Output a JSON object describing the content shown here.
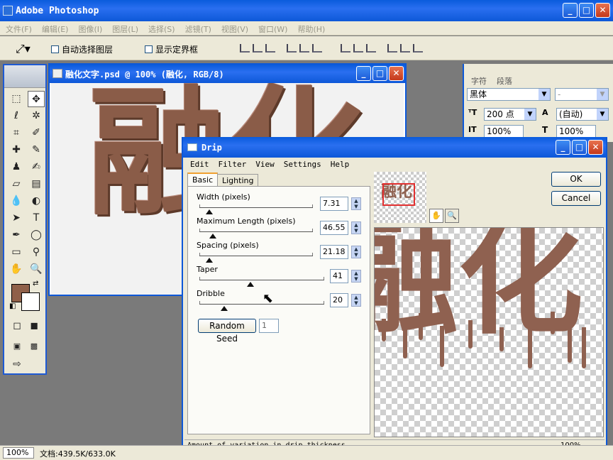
{
  "app": {
    "title": "Adobe Photoshop",
    "menu": [
      "文件(F)",
      "编辑(E)",
      "图像(I)",
      "图层(L)",
      "选择(S)",
      "滤镜(T)",
      "视图(V)",
      "窗口(W)",
      "帮助(H)"
    ],
    "options": {
      "auto_select": "自动选择图层",
      "show_bounds": "显示定界框"
    }
  },
  "document": {
    "title": "融化文字.psd @ 100% (融化, RGB/8)",
    "canvas_text": "融化"
  },
  "character_panel": {
    "tabs": [
      "字符",
      "段落"
    ],
    "font_family": "黑体",
    "font_style": "-",
    "font_size": "200 点",
    "leading": "(自动)",
    "vertical_scale": "100%",
    "horizontal_scale": "100%"
  },
  "drip": {
    "title": "Drip",
    "menu": [
      "Edit",
      "Filter",
      "View",
      "Settings",
      "Help"
    ],
    "tabs": [
      "Basic",
      "Lighting"
    ],
    "params": [
      {
        "label": "Width (pixels)",
        "value": "7.31",
        "level": 0.09
      },
      {
        "label": "Maximum Length (pixels)",
        "value": "46.55",
        "level": 0.12
      },
      {
        "label": "Spacing (pixels)",
        "value": "21.18",
        "level": 0.09
      },
      {
        "label": "Taper",
        "value": "41",
        "level": 0.41
      },
      {
        "label": "Dribble",
        "value": "20",
        "level": 0.2
      }
    ],
    "random_seed_label": "Random Seed",
    "random_seed_value": "1",
    "ok_label": "OK",
    "cancel_label": "Cancel",
    "preview_text": "融化",
    "status_text": "Amount of variation in drip thickness",
    "zoom": "100%"
  },
  "status": {
    "zoom": "100%",
    "doc_info": "文档:439.5K/633.0K"
  },
  "colors": {
    "foreground": "#8f6049",
    "background": "#ffffff",
    "text_brown": "#8a5c48",
    "title_blue": "#0d58d8"
  }
}
